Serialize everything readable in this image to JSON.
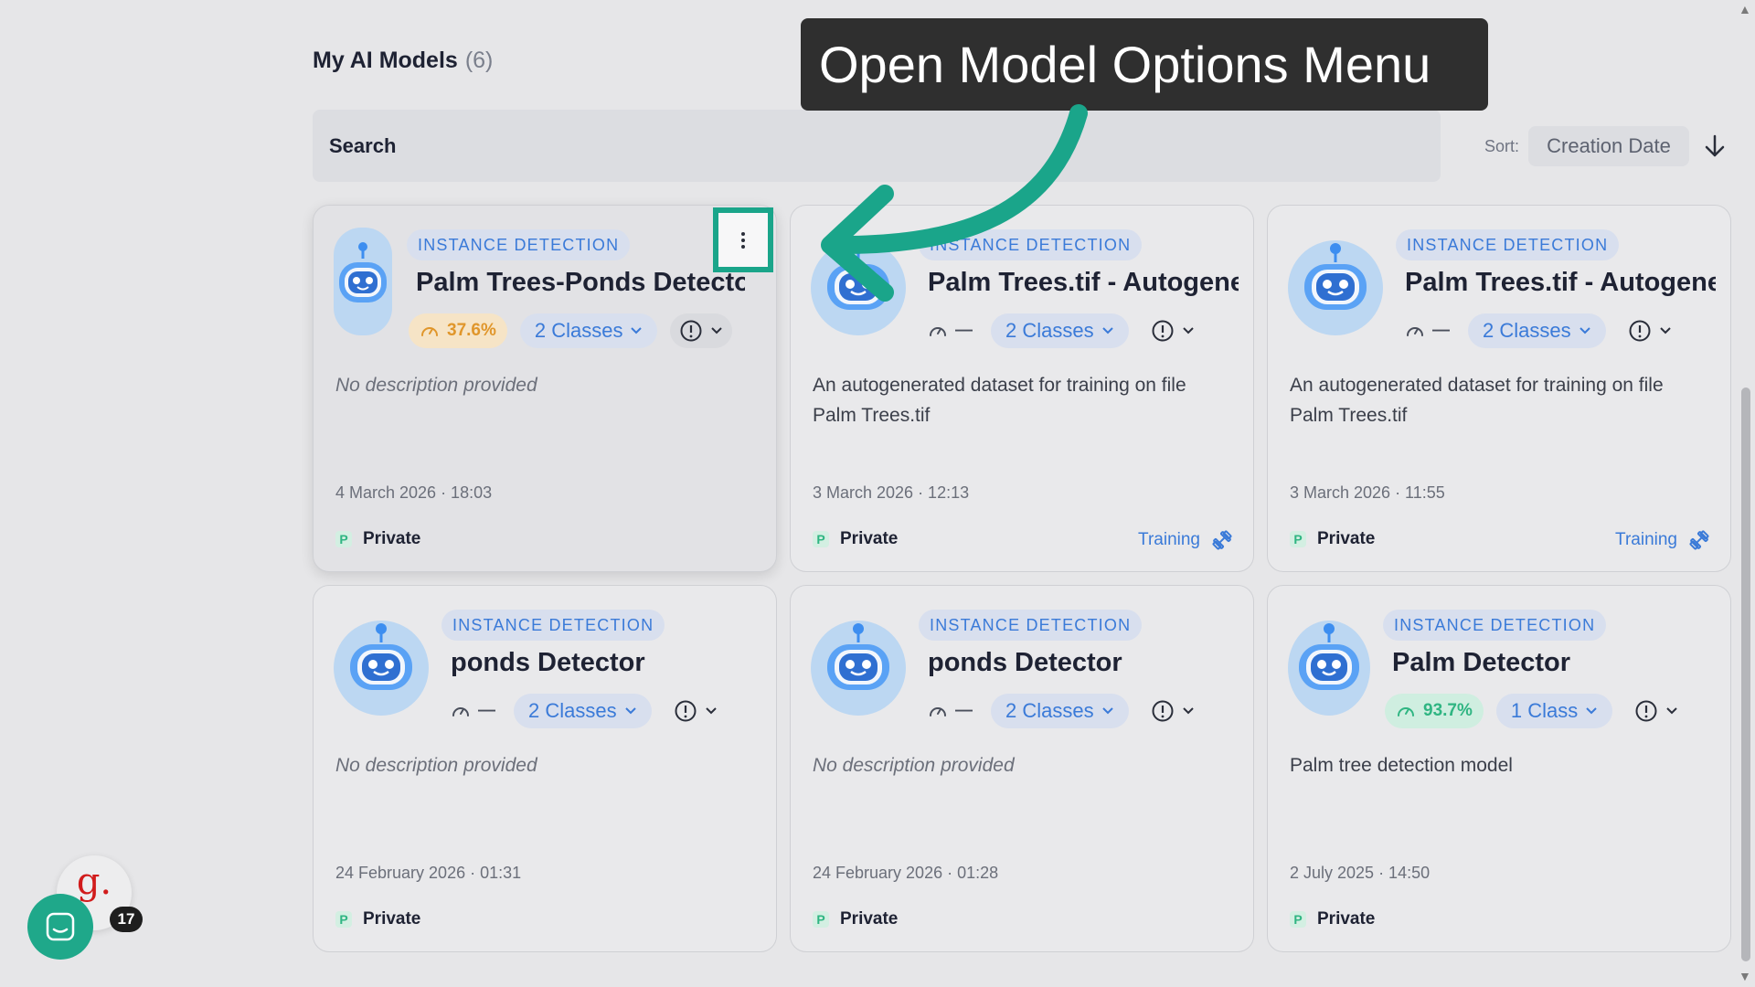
{
  "page": {
    "title": "My AI Models",
    "count": "(6)"
  },
  "search": {
    "placeholder": "Search"
  },
  "sort": {
    "label": "Sort:",
    "value": "Creation Date"
  },
  "tooltip": {
    "text": "Open Model Options Menu"
  },
  "models": [
    {
      "type": "INSTANCE DETECTION",
      "name": "Palm Trees-Ponds Detector",
      "accuracy": "37.6%",
      "classes": "2 Classes",
      "description": "No description provided",
      "date": "4 March 2026 · 18:03",
      "privacy": "Private",
      "privacy_initial": "P",
      "status": ""
    },
    {
      "type": "INSTANCE DETECTION",
      "name": "Palm Trees.tif - Autogene",
      "accuracy": "—",
      "classes": "2 Classes",
      "description": "An autogenerated dataset for training on file Palm Trees.tif",
      "date": "3 March 2026 · 12:13",
      "privacy": "Private",
      "privacy_initial": "P",
      "status": "Training"
    },
    {
      "type": "INSTANCE DETECTION",
      "name": "Palm Trees.tif - Autogene",
      "accuracy": "—",
      "classes": "2 Classes",
      "description": "An autogenerated dataset for training on file Palm Trees.tif",
      "date": "3 March 2026 · 11:55",
      "privacy": "Private",
      "privacy_initial": "P",
      "status": "Training"
    },
    {
      "type": "INSTANCE DETECTION",
      "name": "ponds Detector",
      "accuracy": "—",
      "classes": "2 Classes",
      "description": "No description provided",
      "date": "24 February 2026 · 01:31",
      "privacy": "Private",
      "privacy_initial": "P",
      "status": ""
    },
    {
      "type": "INSTANCE DETECTION",
      "name": "ponds Detector",
      "accuracy": "—",
      "classes": "2 Classes",
      "description": "No description provided",
      "date": "24 February 2026 · 01:28",
      "privacy": "Private",
      "privacy_initial": "P",
      "status": ""
    },
    {
      "type": "INSTANCE DETECTION",
      "name": "Palm Detector",
      "accuracy": "93.7%",
      "classes": "1 Class",
      "description": "Palm tree detection model",
      "date": "2 July 2025 · 14:50",
      "privacy": "Private",
      "privacy_initial": "P",
      "status": ""
    }
  ],
  "widgets": {
    "g_logo": "g.",
    "notification_count": "17"
  },
  "colors": {
    "accent_teal": "#1aa58a",
    "link_blue": "#3a7ad8",
    "warn": "#e0962b",
    "good": "#2fb582"
  }
}
